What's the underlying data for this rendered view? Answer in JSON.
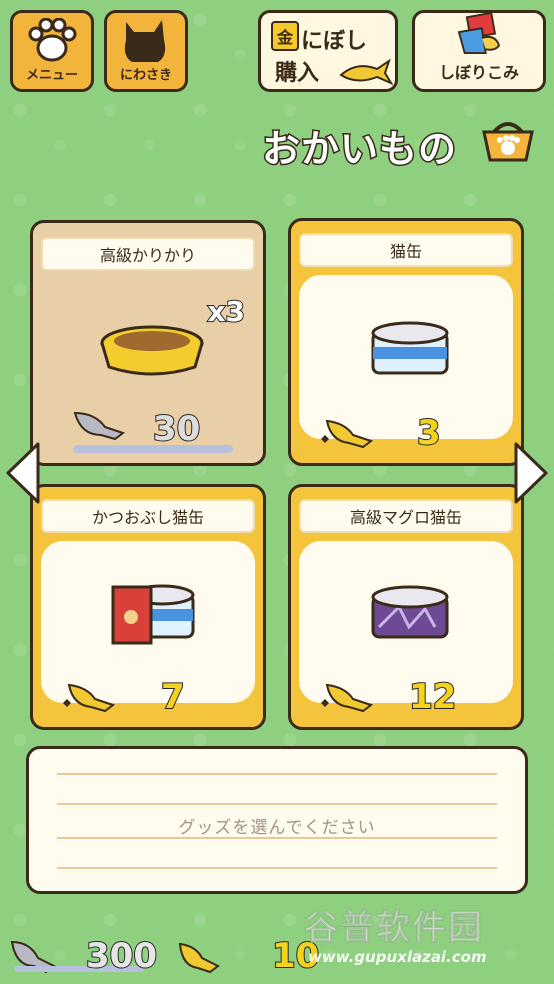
{
  "top": {
    "menu_label": "メニュー",
    "yard_label": "にわさき",
    "buy_gold": "金",
    "buy_line1": "にぼし",
    "buy_line2": "購入",
    "squeeze_label": "しぼりこみ"
  },
  "title": "おかいもの",
  "items": [
    {
      "name": "高級かりかり",
      "qty": "x3",
      "price": "30",
      "currency": "silver-fish",
      "selected": true
    },
    {
      "name": "猫缶",
      "price": "3",
      "currency": "gold-fish",
      "selected": false
    },
    {
      "name": "かつおぶし猫缶",
      "price": "7",
      "currency": "gold-fish",
      "selected": false
    },
    {
      "name": "高級マグロ猫缶",
      "price": "12",
      "currency": "gold-fish",
      "selected": false
    }
  ],
  "description": "グッズを選んでください",
  "balance": {
    "silver": "300",
    "gold": "10"
  },
  "watermark": {
    "line1": "谷普软件园",
    "line2": "www.gupuxlazai.com"
  }
}
